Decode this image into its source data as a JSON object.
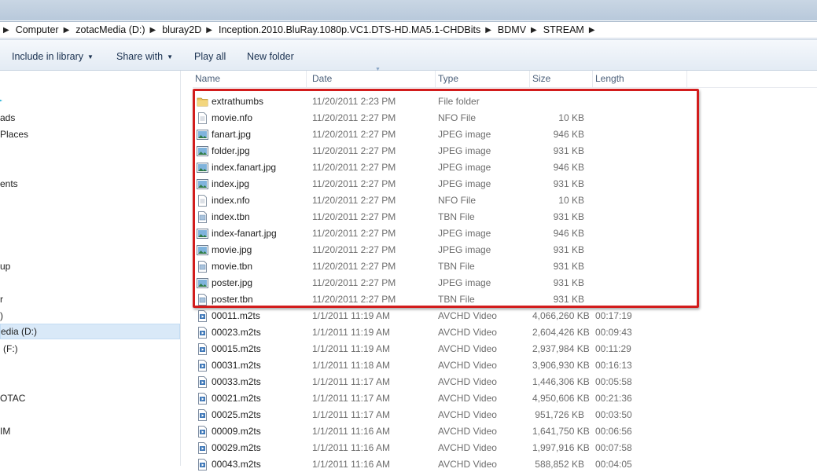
{
  "address": {
    "crumbs": [
      "Computer",
      "zotacMedia (D:)",
      "bluray2D",
      "Inception.2010.BluRay.1080p.VC1.DTS-HD.MA5.1-CHDBits",
      "BDMV",
      "STREAM"
    ]
  },
  "toolbar": {
    "include_in_library": "Include in library",
    "share_with": "Share with",
    "play_all": "Play all",
    "new_folder": "New folder"
  },
  "nav": {
    "items": [
      {
        "label": "ads"
      },
      {
        "label": "Places"
      },
      {
        "label": "ents"
      },
      {
        "label": "up"
      },
      {
        "label": "r"
      },
      {
        "label": ")"
      },
      {
        "label": "edia (D:)"
      },
      {
        "label": "(F:)"
      },
      {
        "label": "OTAC"
      },
      {
        "label": "IM"
      }
    ]
  },
  "columns": {
    "name": "Name",
    "date": "Date",
    "type": "Type",
    "size": "Size",
    "length": "Length"
  },
  "files": [
    {
      "name": "extrathumbs",
      "date": "11/20/2011 2:23 PM",
      "type": "File folder",
      "size": "",
      "length": "",
      "icon": "folder-icon"
    },
    {
      "name": "movie.nfo",
      "date": "11/20/2011 2:27 PM",
      "type": "NFO File",
      "size": "10 KB",
      "length": "",
      "icon": "text-file-icon"
    },
    {
      "name": "fanart.jpg",
      "date": "11/20/2011 2:27 PM",
      "type": "JPEG image",
      "size": "946 KB",
      "length": "",
      "icon": "image-file-icon"
    },
    {
      "name": "folder.jpg",
      "date": "11/20/2011 2:27 PM",
      "type": "JPEG image",
      "size": "931 KB",
      "length": "",
      "icon": "image-file-icon"
    },
    {
      "name": "index.fanart.jpg",
      "date": "11/20/2011 2:27 PM",
      "type": "JPEG image",
      "size": "946 KB",
      "length": "",
      "icon": "image-file-icon"
    },
    {
      "name": "index.jpg",
      "date": "11/20/2011 2:27 PM",
      "type": "JPEG image",
      "size": "931 KB",
      "length": "",
      "icon": "image-file-icon"
    },
    {
      "name": "index.nfo",
      "date": "11/20/2011 2:27 PM",
      "type": "NFO File",
      "size": "10 KB",
      "length": "",
      "icon": "text-file-icon"
    },
    {
      "name": "index.tbn",
      "date": "11/20/2011 2:27 PM",
      "type": "TBN File",
      "size": "931 KB",
      "length": "",
      "icon": "tbn-file-icon"
    },
    {
      "name": "index-fanart.jpg",
      "date": "11/20/2011 2:27 PM",
      "type": "JPEG image",
      "size": "946 KB",
      "length": "",
      "icon": "image-file-icon"
    },
    {
      "name": "movie.jpg",
      "date": "11/20/2011 2:27 PM",
      "type": "JPEG image",
      "size": "931 KB",
      "length": "",
      "icon": "image-file-icon"
    },
    {
      "name": "movie.tbn",
      "date": "11/20/2011 2:27 PM",
      "type": "TBN File",
      "size": "931 KB",
      "length": "",
      "icon": "tbn-file-icon"
    },
    {
      "name": "poster.jpg",
      "date": "11/20/2011 2:27 PM",
      "type": "JPEG image",
      "size": "931 KB",
      "length": "",
      "icon": "image-file-icon"
    },
    {
      "name": "poster.tbn",
      "date": "11/20/2011 2:27 PM",
      "type": "TBN File",
      "size": "931 KB",
      "length": "",
      "icon": "tbn-file-icon"
    },
    {
      "name": "00011.m2ts",
      "date": "1/1/2011 11:19 AM",
      "type": "AVCHD Video",
      "size": "4,066,260 KB",
      "length": "00:17:19",
      "icon": "video-file-icon"
    },
    {
      "name": "00023.m2ts",
      "date": "1/1/2011 11:19 AM",
      "type": "AVCHD Video",
      "size": "2,604,426 KB",
      "length": "00:09:43",
      "icon": "video-file-icon"
    },
    {
      "name": "00015.m2ts",
      "date": "1/1/2011 11:19 AM",
      "type": "AVCHD Video",
      "size": "2,937,984 KB",
      "length": "00:11:29",
      "icon": "video-file-icon"
    },
    {
      "name": "00031.m2ts",
      "date": "1/1/2011 11:18 AM",
      "type": "AVCHD Video",
      "size": "3,906,930 KB",
      "length": "00:16:13",
      "icon": "video-file-icon"
    },
    {
      "name": "00033.m2ts",
      "date": "1/1/2011 11:17 AM",
      "type": "AVCHD Video",
      "size": "1,446,306 KB",
      "length": "00:05:58",
      "icon": "video-file-icon"
    },
    {
      "name": "00021.m2ts",
      "date": "1/1/2011 11:17 AM",
      "type": "AVCHD Video",
      "size": "4,950,606 KB",
      "length": "00:21:36",
      "icon": "video-file-icon"
    },
    {
      "name": "00025.m2ts",
      "date": "1/1/2011 11:17 AM",
      "type": "AVCHD Video",
      "size": "951,726 KB",
      "length": "00:03:50",
      "icon": "video-file-icon"
    },
    {
      "name": "00009.m2ts",
      "date": "1/1/2011 11:16 AM",
      "type": "AVCHD Video",
      "size": "1,641,750 KB",
      "length": "00:06:56",
      "icon": "video-file-icon"
    },
    {
      "name": "00029.m2ts",
      "date": "1/1/2011 11:16 AM",
      "type": "AVCHD Video",
      "size": "1,997,916 KB",
      "length": "00:07:58",
      "icon": "video-file-icon"
    },
    {
      "name": "00043.m2ts",
      "date": "1/1/2011 11:16 AM",
      "type": "AVCHD Video",
      "size": "588,852 KB",
      "length": "00:04:05",
      "icon": "video-file-icon"
    }
  ],
  "colors": {
    "highlight": "#d21c1c",
    "selection": "#d9e9f8",
    "folder": "#e8c15a"
  }
}
